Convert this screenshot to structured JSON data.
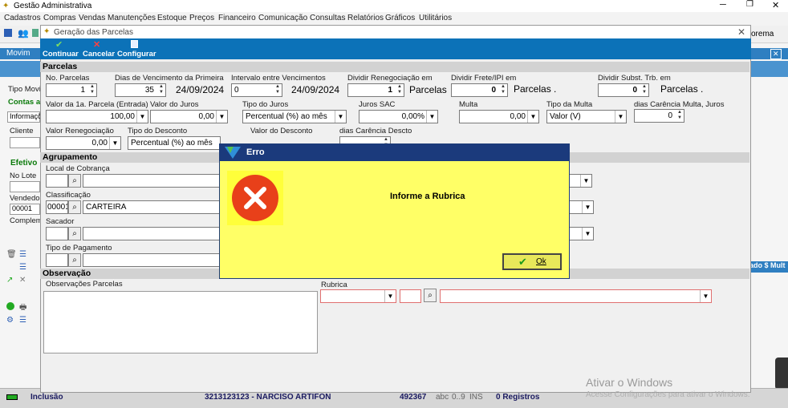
{
  "app": {
    "title": "Gestão Administrativa",
    "menu": [
      "Cadastros",
      "Compras",
      "Vendas",
      "Manutenções",
      "Estoque",
      "Preços",
      "Financeiro",
      "Comunicação",
      "Consultas",
      "Relatórios",
      "Gráficos",
      "Utilitários"
    ],
    "right_tool_text": "orema"
  },
  "background": {
    "title_partial": "Movim",
    "tab_partial": "Informaçõ",
    "tipo_movi": "Tipo Movi",
    "contas": "Contas a",
    "cliente": "Cliente",
    "efetivo": "Efetivo",
    "no_lote": "No Lote",
    "vendedor": "Vendedor",
    "vendedor_value": "00001",
    "complem": "Complem",
    "right_header": "ado  $ Mult"
  },
  "status": {
    "mode": "Inclusão",
    "doc": "3213123123 - NARCISO ARTIFON",
    "code": "492367",
    "abc": "abc",
    "num": "0..9",
    "ins": "INS",
    "registros": "0 Registros"
  },
  "dialog": {
    "title": "Geração das Parcelas",
    "toolbar": {
      "continuar": "Continuar",
      "cancelar": "Cancelar",
      "configurar": "Configurar"
    },
    "sections": {
      "parcelas": "Parcelas",
      "agrupamento": "Agrupamento",
      "observacao": "Observação"
    },
    "parcelas": {
      "no_parcelas_label": "No. Parcelas",
      "no_parcelas": "1",
      "dias_label": "Dias de Vencimento da Primeira",
      "dias": "35",
      "dias_date": "24/09/2024",
      "intervalo_label": "Intervalo entre Vencimentos",
      "intervalo": "0",
      "intervalo_date": "24/09/2024",
      "dividir_reneg_label": "Dividir Renegociação em",
      "dividir_reneg": "1",
      "parcelas_word": "Parcelas",
      "dividir_frete_label": "Dividir Frete/IPI em",
      "dividir_frete": "0",
      "parcelas_word2": "Parcelas .",
      "dividir_subst_label": "Dividir Subst. Trb. em",
      "dividir_subst": "0",
      "parcelas_word3": "Parcelas .",
      "valor_1a_label": "Valor da 1a. Parcela (Entrada)",
      "valor_1a": "100,00",
      "valor_juros_label": "Valor do Juros",
      "valor_juros": "0,00",
      "tipo_juros_label": "Tipo do Juros",
      "tipo_juros": "Percentual (%)  ao mês",
      "juros_sac_label": "Juros SAC",
      "juros_sac": "0,00%",
      "multa_label": "Multa",
      "multa": "0,00",
      "tipo_multa_label": "Tipo da Multa",
      "tipo_multa": "Valor (V)",
      "dias_carencia_label": "dias Carência Multa, Juros",
      "dias_carencia": "0",
      "valor_reneg_label": "Valor Renegociação",
      "valor_reneg": "0,00",
      "tipo_desconto_label": "Tipo do Desconto",
      "tipo_desconto": "Percentual (%)  ao mês",
      "valor_desconto_label": "Valor do Desconto",
      "dias_carencia_desc_label": "dias Carência Descto"
    },
    "agrupamento": {
      "local_label": "Local de Cobrança",
      "classificacao_label": "Classificação",
      "classificacao_code": "00001",
      "classificacao_name": "CARTEIRA",
      "sacador_label": "Sacador",
      "tipo_pagamento_label": "Tipo de Pagamento"
    },
    "observacao": {
      "obs_label": "Observações Parcelas",
      "rubrica_label": "Rubrica"
    }
  },
  "error": {
    "title": "Erro",
    "message": "Informe a Rubrica",
    "ok_label": "Ok"
  },
  "watermark": {
    "line1": "Ativar o Windows",
    "line2": "Acesse Configurações para ativar o Windows."
  },
  "colors": {
    "dialog_toolbar": "#0c72b8",
    "error_bg": "#ffff66",
    "error_title": "#1b3a7c",
    "error_icon": "#e8401a"
  }
}
